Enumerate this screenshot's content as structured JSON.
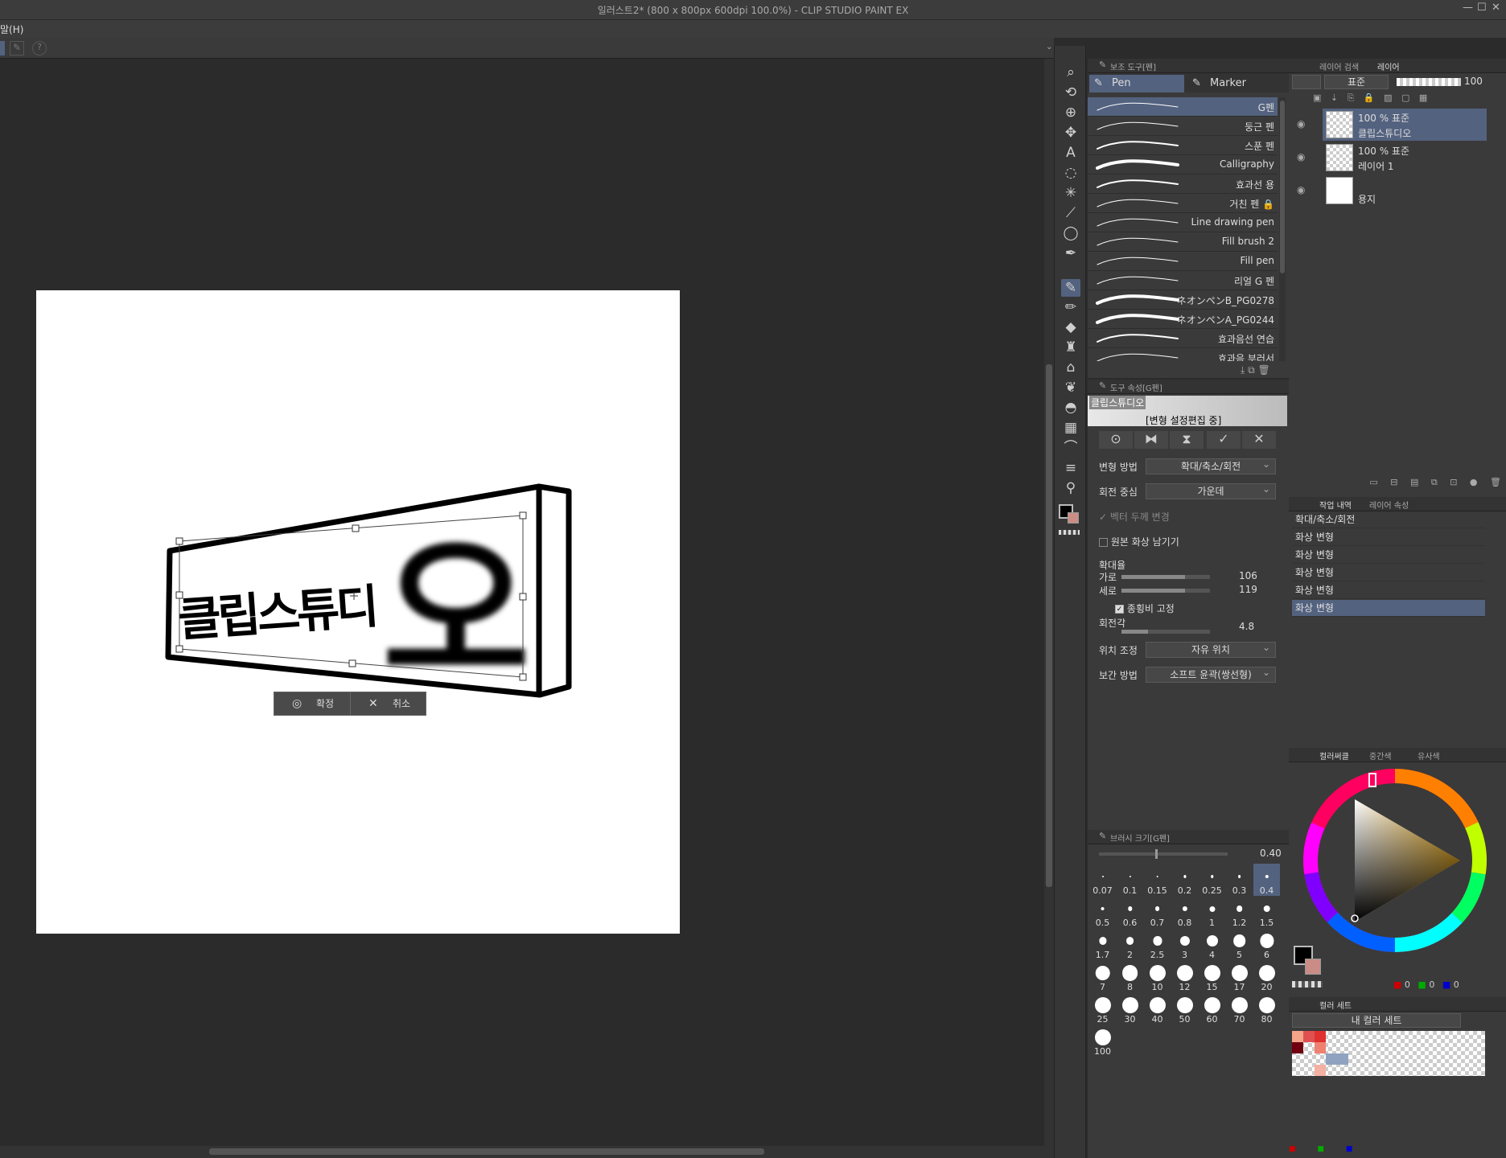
{
  "window": {
    "title": "일러스트2* (800 x 800px 600dpi 100.0%)  - CLIP STUDIO PAINT EX",
    "controls": [
      "—",
      "☐",
      "✕"
    ]
  },
  "menu": {
    "visible_label": "말(H)"
  },
  "canvas": {
    "artwork_text_left": "클립스튜디",
    "artwork_text_right": "오",
    "confirm_label": "확정",
    "cancel_label": "취소"
  },
  "subtool_panel": {
    "title": "보조 도구[펜]",
    "tabs": [
      {
        "label": "Pen"
      },
      {
        "label": "Marker"
      }
    ],
    "brushes": [
      {
        "name": "G펜",
        "selected": true
      },
      {
        "name": "둥근 펜"
      },
      {
        "name": "스푼 펜"
      },
      {
        "name": "Calligraphy"
      },
      {
        "name": "효과선 용"
      },
      {
        "name": "거친 펜 🔒"
      },
      {
        "name": "Line drawing pen"
      },
      {
        "name": "Fill brush 2"
      },
      {
        "name": "Fill pen"
      },
      {
        "name": "리얼 G 펜"
      },
      {
        "name": "ネオンペンB_PG0278"
      },
      {
        "name": "ネオンペンA_PG0244"
      },
      {
        "name": "효과음선 연습"
      },
      {
        "name": "효과음 부러서"
      }
    ]
  },
  "tool_property": {
    "title": "도구 속성[G펜]",
    "preview_label": "클립스튜디오",
    "editing_label": "[변형 설정편집 중]",
    "transform_method_label": "변형 방법",
    "transform_method_value": "확대/축소/회전",
    "rotation_center_label": "회전 중심",
    "rotation_center_value": "가운데",
    "vector_width_label": "벡터 두께 변경",
    "keep_original_label": "원본 화상 남기기",
    "scale_label": "확대율",
    "width_label": "가로",
    "width_value": "106",
    "width_fraction": 0.72,
    "height_label": "세로",
    "height_value": "119",
    "height_fraction": 0.72,
    "keep_ratio_label": "종횡비 고정",
    "rotation_label": "회전각",
    "rotation_value": "4.8",
    "position_label": "위치 조정",
    "position_value": "자유 위치",
    "interp_label": "보간 방법",
    "interp_value": "소프트 윤곽(쌍선형)"
  },
  "brush_size": {
    "title": "브러시 크기[G펜]",
    "current": "0.40",
    "sizes": [
      "0.07",
      "0.1",
      "0.15",
      "0.2",
      "0.25",
      "0.3",
      "0.4",
      "0.5",
      "0.6",
      "0.7",
      "0.8",
      "1",
      "1.2",
      "1.5",
      "1.7",
      "2",
      "2.5",
      "3",
      "4",
      "5",
      "6",
      "7",
      "8",
      "10",
      "12",
      "15",
      "17",
      "20",
      "25",
      "30",
      "40",
      "50",
      "60",
      "70",
      "80",
      "100"
    ],
    "selected": "0.4"
  },
  "layer_panel": {
    "tabs": [
      "레이어 검색",
      "레이어"
    ],
    "blend_mode": "표준",
    "opacity": "100",
    "layers": [
      {
        "mode": "100 % 표준",
        "name": "클립스튜디오",
        "selected": true
      },
      {
        "mode": "100 % 표준",
        "name": "레이어 1"
      },
      {
        "mode": "",
        "name": "용지"
      }
    ]
  },
  "history_panel": {
    "tabs": [
      "작업 내역",
      "레이어 속성"
    ],
    "items": [
      {
        "label": "확대/축소/회전"
      },
      {
        "label": "화상 변형"
      },
      {
        "label": "화상 변형"
      },
      {
        "label": "화상 변형"
      },
      {
        "label": "화상 변형"
      },
      {
        "label": "화상 변형",
        "selected": true
      }
    ]
  },
  "color_panel": {
    "tabs": [
      "컬러써클",
      "중간색",
      "유사색"
    ],
    "rgb": [
      "0",
      "0",
      "0"
    ],
    "main_color": "#000000",
    "sub_color": "#c98d86"
  },
  "color_set": {
    "title": "컬러 세트",
    "set_name": "내 컬러 세트"
  },
  "colors": {
    "accent": "#53627f",
    "panel": "#3a3a3a",
    "bg": "#2b2b2b"
  }
}
